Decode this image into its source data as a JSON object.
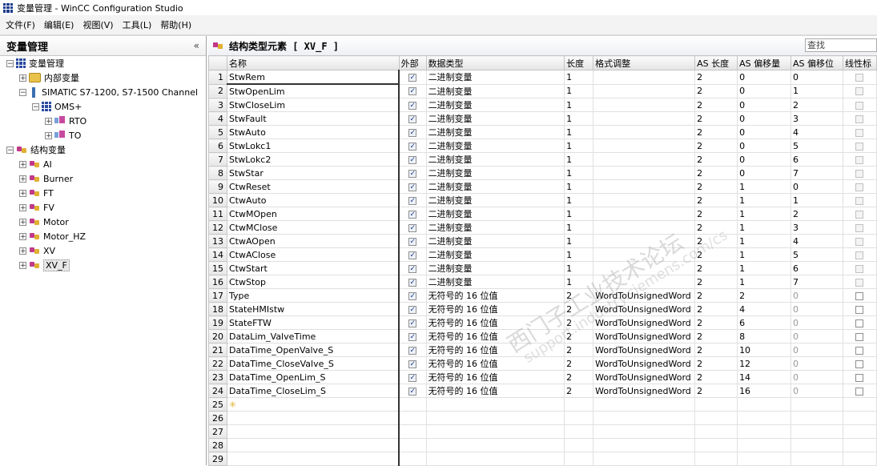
{
  "window": {
    "title": "变量管理 - WinCC Configuration Studio"
  },
  "menu": [
    "文件(F)",
    "编辑(E)",
    "视图(V)",
    "工具(L)",
    "帮助(H)"
  ],
  "left": {
    "title": "变量管理",
    "collapse": "«",
    "tree": [
      {
        "label": "变量管理",
        "level": 0,
        "expander": "−",
        "icon": "grid-icon"
      },
      {
        "label": "内部变量",
        "level": 1,
        "expander": "+",
        "icon": "folder-icon"
      },
      {
        "label": "SIMATIC S7-1200, S7-1500 Channel",
        "level": 1,
        "expander": "−",
        "icon": "channel-icon"
      },
      {
        "label": "OMS+",
        "level": 2,
        "expander": "−",
        "icon": "connection-icon"
      },
      {
        "label": "RTO",
        "level": 3,
        "expander": "+",
        "icon": "tag-group-icon"
      },
      {
        "label": "TO",
        "level": 3,
        "expander": "+",
        "icon": "tag-group-icon"
      },
      {
        "label": "结构变量",
        "level": 0,
        "expander": "−",
        "icon": "struct-folder-icon"
      },
      {
        "label": "AI",
        "level": 1,
        "expander": "+",
        "icon": "struct-type-icon"
      },
      {
        "label": "Burner",
        "level": 1,
        "expander": "+",
        "icon": "struct-type-icon"
      },
      {
        "label": "FT",
        "level": 1,
        "expander": "+",
        "icon": "struct-type-icon"
      },
      {
        "label": "FV",
        "level": 1,
        "expander": "+",
        "icon": "struct-type-icon"
      },
      {
        "label": "Motor",
        "level": 1,
        "expander": "+",
        "icon": "struct-type-icon"
      },
      {
        "label": "Motor_HZ",
        "level": 1,
        "expander": "+",
        "icon": "struct-type-icon"
      },
      {
        "label": "XV",
        "level": 1,
        "expander": "+",
        "icon": "struct-type-icon"
      },
      {
        "label": "XV_F",
        "level": 1,
        "expander": "+",
        "icon": "struct-type-icon",
        "selected": true
      }
    ]
  },
  "right": {
    "title": "结构类型元素 [ XV_F ]",
    "search_placeholder": "查找",
    "columns": [
      "名称",
      "外部",
      "数据类型",
      "长度",
      "格式调整",
      "AS 长度",
      "AS 偏移量",
      "AS 偏移位",
      "线性标"
    ],
    "rows": [
      {
        "n": "1",
        "name": "StwRem",
        "type": "二进制变量",
        "len": "1",
        "fmt": "",
        "aslen": "2",
        "asoff": "0",
        "asbit": "0"
      },
      {
        "n": "2",
        "name": "StwOpenLim",
        "type": "二进制变量",
        "len": "1",
        "fmt": "",
        "aslen": "2",
        "asoff": "0",
        "asbit": "1"
      },
      {
        "n": "3",
        "name": "StwCloseLim",
        "type": "二进制变量",
        "len": "1",
        "fmt": "",
        "aslen": "2",
        "asoff": "0",
        "asbit": "2"
      },
      {
        "n": "4",
        "name": "StwFault",
        "type": "二进制变量",
        "len": "1",
        "fmt": "",
        "aslen": "2",
        "asoff": "0",
        "asbit": "3"
      },
      {
        "n": "5",
        "name": "StwAuto",
        "type": "二进制变量",
        "len": "1",
        "fmt": "",
        "aslen": "2",
        "asoff": "0",
        "asbit": "4"
      },
      {
        "n": "6",
        "name": "StwLokc1",
        "type": "二进制变量",
        "len": "1",
        "fmt": "",
        "aslen": "2",
        "asoff": "0",
        "asbit": "5"
      },
      {
        "n": "7",
        "name": "StwLokc2",
        "type": "二进制变量",
        "len": "1",
        "fmt": "",
        "aslen": "2",
        "asoff": "0",
        "asbit": "6"
      },
      {
        "n": "8",
        "name": "StwStar",
        "type": "二进制变量",
        "len": "1",
        "fmt": "",
        "aslen": "2",
        "asoff": "0",
        "asbit": "7"
      },
      {
        "n": "9",
        "name": "CtwReset",
        "type": "二进制变量",
        "len": "1",
        "fmt": "",
        "aslen": "2",
        "asoff": "1",
        "asbit": "0"
      },
      {
        "n": "10",
        "name": "CtwAuto",
        "type": "二进制变量",
        "len": "1",
        "fmt": "",
        "aslen": "2",
        "asoff": "1",
        "asbit": "1"
      },
      {
        "n": "11",
        "name": "CtwMOpen",
        "type": "二进制变量",
        "len": "1",
        "fmt": "",
        "aslen": "2",
        "asoff": "1",
        "asbit": "2"
      },
      {
        "n": "12",
        "name": "CtwMClose",
        "type": "二进制变量",
        "len": "1",
        "fmt": "",
        "aslen": "2",
        "asoff": "1",
        "asbit": "3"
      },
      {
        "n": "13",
        "name": "CtwAOpen",
        "type": "二进制变量",
        "len": "1",
        "fmt": "",
        "aslen": "2",
        "asoff": "1",
        "asbit": "4"
      },
      {
        "n": "14",
        "name": "CtwAClose",
        "type": "二进制变量",
        "len": "1",
        "fmt": "",
        "aslen": "2",
        "asoff": "1",
        "asbit": "5"
      },
      {
        "n": "15",
        "name": "CtwStart",
        "type": "二进制变量",
        "len": "1",
        "fmt": "",
        "aslen": "2",
        "asoff": "1",
        "asbit": "6"
      },
      {
        "n": "16",
        "name": "CtwStop",
        "type": "二进制变量",
        "len": "1",
        "fmt": "",
        "aslen": "2",
        "asoff": "1",
        "asbit": "7"
      },
      {
        "n": "17",
        "name": "Type",
        "type": "无符号的 16 位值",
        "len": "2",
        "fmt": "WordToUnsignedWord",
        "aslen": "2",
        "asoff": "2",
        "asbit": "0"
      },
      {
        "n": "18",
        "name": "StateHMIstw",
        "type": "无符号的 16 位值",
        "len": "2",
        "fmt": "WordToUnsignedWord",
        "aslen": "2",
        "asoff": "4",
        "asbit": "0"
      },
      {
        "n": "19",
        "name": "StateFTW",
        "type": "无符号的 16 位值",
        "len": "2",
        "fmt": "WordToUnsignedWord",
        "aslen": "2",
        "asoff": "6",
        "asbit": "0"
      },
      {
        "n": "20",
        "name": "DataLim_ValveTime",
        "type": "无符号的 16 位值",
        "len": "2",
        "fmt": "WordToUnsignedWord",
        "aslen": "2",
        "asoff": "8",
        "asbit": "0"
      },
      {
        "n": "21",
        "name": "DataTime_OpenValve_S",
        "type": "无符号的 16 位值",
        "len": "2",
        "fmt": "WordToUnsignedWord",
        "aslen": "2",
        "asoff": "10",
        "asbit": "0"
      },
      {
        "n": "22",
        "name": "DataTime_CloseValve_S",
        "type": "无符号的 16 位值",
        "len": "2",
        "fmt": "WordToUnsignedWord",
        "aslen": "2",
        "asoff": "12",
        "asbit": "0"
      },
      {
        "n": "23",
        "name": "DataTime_OpenLim_S",
        "type": "无符号的 16 位值",
        "len": "2",
        "fmt": "WordToUnsignedWord",
        "aslen": "2",
        "asoff": "14",
        "asbit": "0"
      },
      {
        "n": "24",
        "name": "DataTime_CloseLim_S",
        "type": "无符号的 16 位值",
        "len": "2",
        "fmt": "WordToUnsignedWord",
        "aslen": "2",
        "asoff": "16",
        "asbit": "0"
      }
    ],
    "empty_rows": [
      "25",
      "26",
      "27",
      "28",
      "29"
    ],
    "new_row_marker": "✳"
  },
  "watermark": {
    "line1": "西门子工业技术论坛",
    "line2": "support.industry.siemens.com/cs"
  }
}
